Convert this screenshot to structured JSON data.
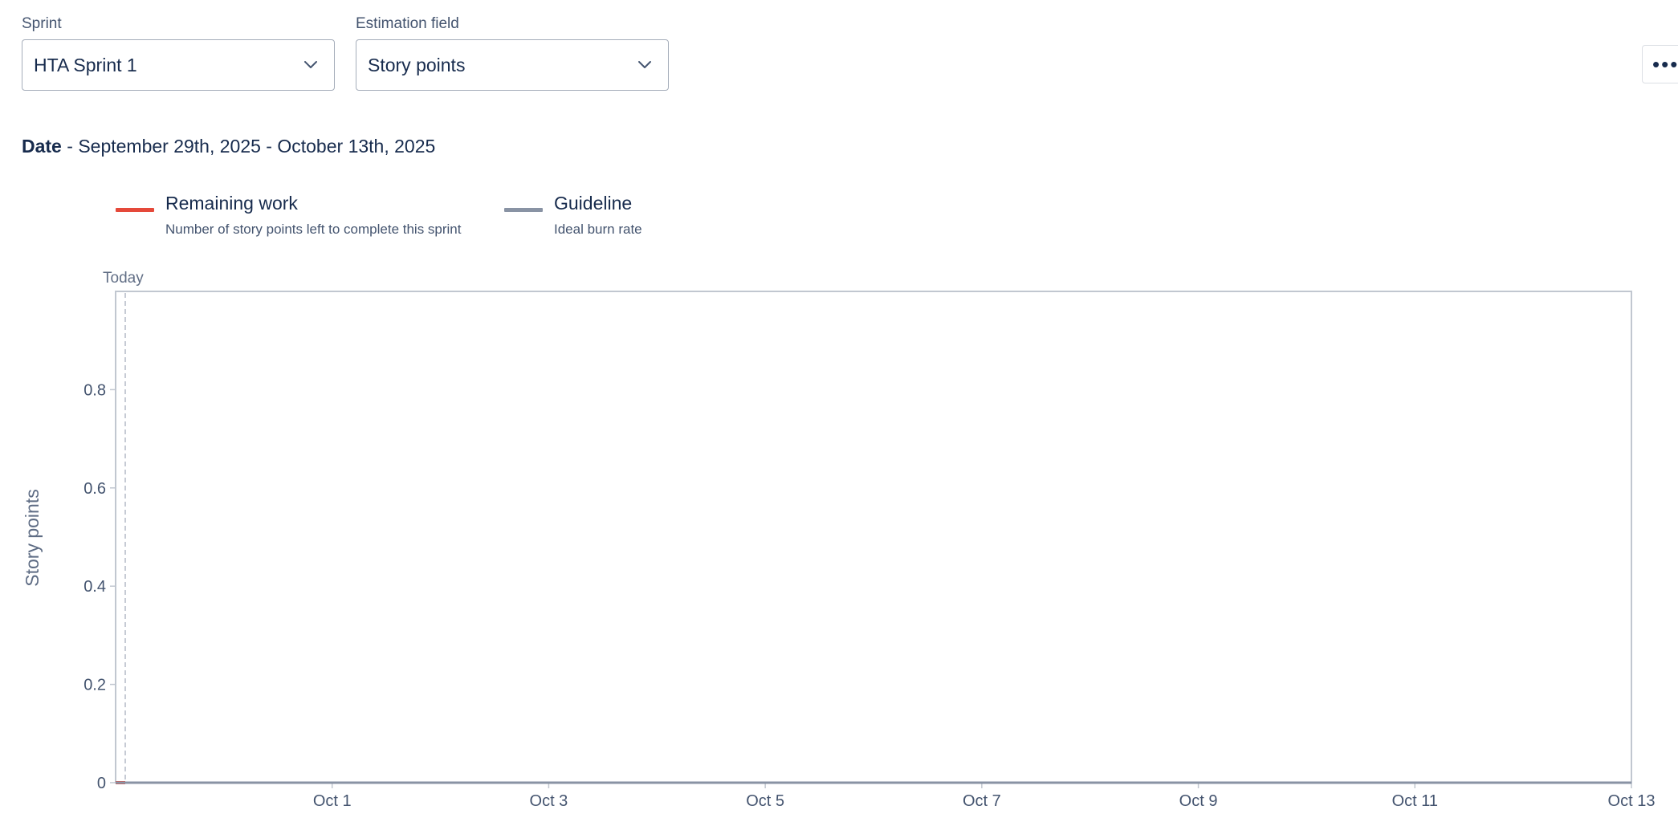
{
  "filters": {
    "sprint": {
      "label": "Sprint",
      "value": "HTA Sprint 1"
    },
    "estimation": {
      "label": "Estimation field",
      "value": "Story points"
    }
  },
  "toolbar": {
    "more_label": "•••"
  },
  "date_range": {
    "label": "Date",
    "separator": " - ",
    "value": "September 29th, 2025 - October 13th, 2025"
  },
  "legend": [
    {
      "title": "Remaining work",
      "desc": "Number of story points left to complete this sprint",
      "color": "#e5493a"
    },
    {
      "title": "Guideline",
      "desc": "Ideal burn rate",
      "color": "#8993a4"
    }
  ],
  "icons": {
    "select_chevron": "chevron-down-icon",
    "more": "more-icon"
  },
  "chart_data": {
    "type": "line",
    "ylabel": "Story points",
    "ylim": [
      0,
      1
    ],
    "yticks": [
      0,
      0.2,
      0.4,
      0.6,
      0.8
    ],
    "xlim": [
      "2025-09-29",
      "2025-10-13"
    ],
    "xticks": [
      {
        "date": "2025-10-01",
        "label": "Oct 1"
      },
      {
        "date": "2025-10-03",
        "label": "Oct 3"
      },
      {
        "date": "2025-10-05",
        "label": "Oct 5"
      },
      {
        "date": "2025-10-07",
        "label": "Oct 7"
      },
      {
        "date": "2025-10-09",
        "label": "Oct 9"
      },
      {
        "date": "2025-10-11",
        "label": "Oct 11"
      },
      {
        "date": "2025-10-13",
        "label": "Oct 13"
      }
    ],
    "today": {
      "label": "Today",
      "date": "2025-09-29"
    },
    "series": [
      {
        "name": "Remaining work",
        "color": "#e5493a",
        "points": [
          {
            "x": "2025-09-29",
            "y": 0
          }
        ]
      },
      {
        "name": "Guideline",
        "color": "#8993a4",
        "points": [
          {
            "x": "2025-09-29",
            "y": 0
          },
          {
            "x": "2025-10-13",
            "y": 0
          }
        ]
      }
    ]
  }
}
